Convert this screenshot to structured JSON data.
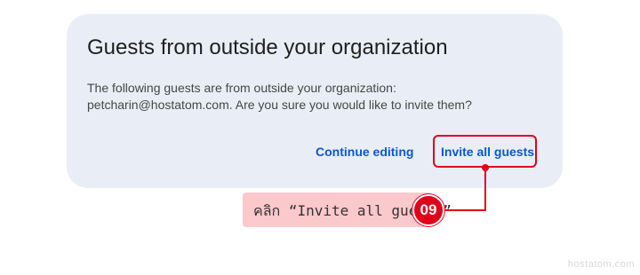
{
  "dialog": {
    "title": "Guests from outside your organization",
    "body": "The following guests are from outside your organization: petcharin@hostatom.com. Are you sure you would like to invite them?",
    "continue_label": "Continue editing",
    "invite_label": "Invite all guests"
  },
  "annotation": {
    "text": "คลิก “Invite all guests”",
    "step": "09"
  },
  "watermark": "hostatom.com",
  "colors": {
    "dialog_bg": "#e9eef6",
    "link_blue": "#0b57d0",
    "highlight_red": "#e0001a",
    "annotation_pink": "#fbc8cc"
  }
}
